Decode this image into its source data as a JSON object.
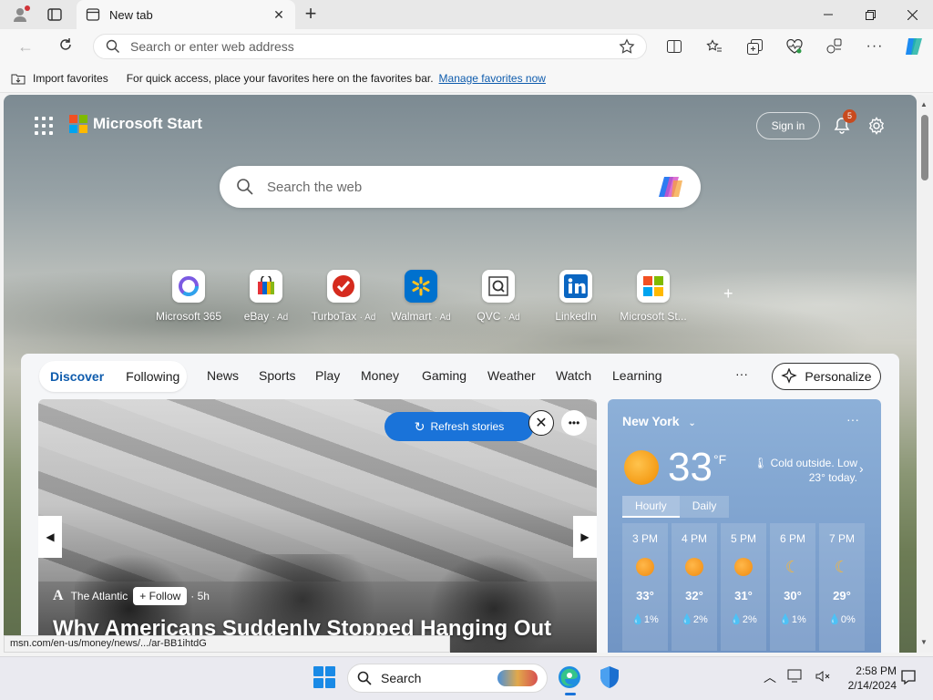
{
  "browser": {
    "tab_title": "New tab",
    "address_placeholder": "Search or enter web address"
  },
  "favorites_bar": {
    "import_label": "Import favorites",
    "message": "For quick access, place your favorites here on the favorites bar.",
    "manage_link": "Manage favorites now"
  },
  "msn": {
    "brand": "Microsoft Start",
    "sign_in": "Sign in",
    "notifications_count": "5",
    "search_placeholder": "Search the web",
    "quick_links": [
      {
        "label": "Microsoft 365",
        "ad": ""
      },
      {
        "label": "eBay",
        "ad": "· Ad"
      },
      {
        "label": "TurboTax",
        "ad": "· Ad"
      },
      {
        "label": "Walmart",
        "ad": "· Ad"
      },
      {
        "label": "QVC",
        "ad": "· Ad"
      },
      {
        "label": "LinkedIn",
        "ad": ""
      },
      {
        "label": "Microsoft St...",
        "ad": ""
      }
    ],
    "add_quick_link": "+"
  },
  "feed": {
    "pivot": [
      "Discover",
      "Following"
    ],
    "nav": [
      "News",
      "Sports",
      "Play",
      "Money",
      "Gaming",
      "Weather",
      "Watch",
      "Learning"
    ],
    "more": "···",
    "personalize": "Personalize",
    "refresh": "Refresh stories",
    "hero": {
      "source": "The Atlantic",
      "follow": "+ Follow",
      "age": "· 5h",
      "headline": "Why Americans Suddenly Stopped Hanging Out"
    }
  },
  "weather": {
    "city": "New York",
    "temp": "33",
    "unit": "°F",
    "description": "Cold outside. Low 23° today.",
    "tabs": [
      "Hourly",
      "Daily"
    ],
    "hourly": [
      {
        "time": "3 PM",
        "icon": "sun",
        "temp": "33°",
        "precip": "1%"
      },
      {
        "time": "4 PM",
        "icon": "sun",
        "temp": "32°",
        "precip": "2%"
      },
      {
        "time": "5 PM",
        "icon": "sun",
        "temp": "31°",
        "precip": "2%"
      },
      {
        "time": "6 PM",
        "icon": "moon",
        "temp": "30°",
        "precip": "1%"
      },
      {
        "time": "7 PM",
        "icon": "moon",
        "temp": "29°",
        "precip": "0%"
      }
    ]
  },
  "status_url": "msn.com/en-us/money/news/.../ar-BB1ihtdG",
  "taskbar": {
    "search_label": "Search",
    "time": "2:58 PM",
    "date": "2/14/2024"
  },
  "colors": {
    "accent": "#1a73d9",
    "link": "#0f5cad",
    "notification": "#c84a1e"
  }
}
